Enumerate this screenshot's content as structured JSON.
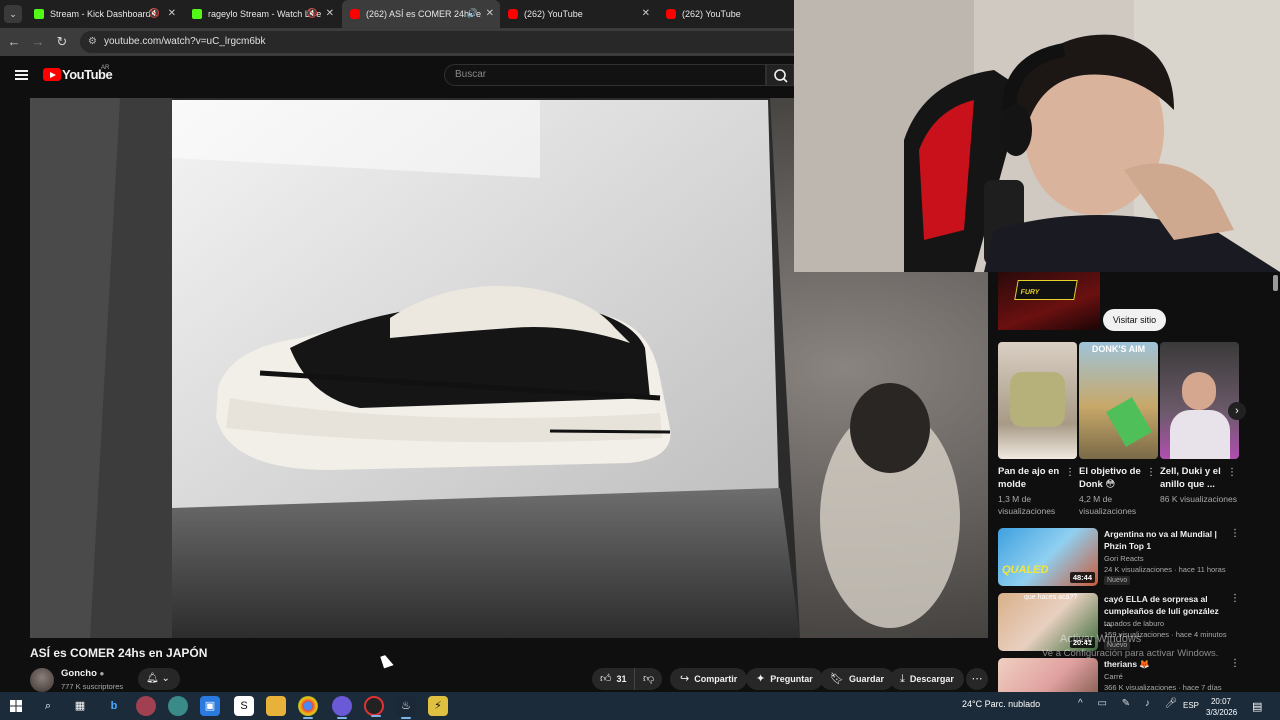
{
  "browser": {
    "tabs": [
      {
        "label": "Stream - Kick Dashboard",
        "favicon_color": "#53fc18",
        "muted": true
      },
      {
        "label": "rageylo Stream - Watch Live",
        "favicon_color": "#53fc18",
        "muted": true
      },
      {
        "label": "(262) ASÍ es COMER 24hs e",
        "favicon_color": "#ff0000",
        "active": true
      },
      {
        "label": "(262) YouTube",
        "favicon_color": "#ff0000"
      },
      {
        "label": "(262) YouTube",
        "favicon_color": "#ff0000"
      }
    ],
    "url": "youtube.com/watch?v=uC_lrgcm6bk"
  },
  "youtube": {
    "brand": "YouTube",
    "country": "AR",
    "search_placeholder": "Buscar",
    "video": {
      "title": "ASÍ es COMER 24hs en JAPÓN",
      "channel": "Goncho",
      "subscribers": "777 K suscriptores",
      "likes": "31",
      "share_label": "Compartir",
      "ask_label": "Preguntar",
      "save_label": "Guardar",
      "download_label": "Descargar"
    },
    "sidebar": {
      "ad_visit_label": "Visitar sitio",
      "ad_brand": "FURY",
      "shorts": [
        {
          "title": "Pan de ajo en molde",
          "views": "1,3 M de visualizaciones",
          "overlay": ""
        },
        {
          "title": "El objetivo de Donk 😳",
          "views": "4,2 M de visualizaciones",
          "overlay": "DONK'S AIM"
        },
        {
          "title": "Zell, Duki y el anillo que ...",
          "views": "86 K visualizaciones",
          "overlay": ""
        }
      ],
      "recommendations": [
        {
          "title": "Argentina no va al Mundial | Phzin Top 1",
          "channel": "Gori Reacts",
          "meta": "24 K visualizaciones · hace 11 horas",
          "badge": "Nuevo",
          "duration": "48:44",
          "thumb_text": "QUALED"
        },
        {
          "title": "cayó ELLA de sorpresa al cumpleaños de luli gonzález ...",
          "channel": "tapados de laburo",
          "meta": "159 visualizaciones · hace 4 minutos",
          "badge": "Nuevo",
          "duration": "20:41",
          "thumb_text": "que haces acá??"
        },
        {
          "title": "therians 🦊",
          "channel": "Carré",
          "meta": "366 K visualizaciones · hace 7 días",
          "badge": "",
          "duration": "",
          "thumb_text": ""
        }
      ]
    }
  },
  "watermark": {
    "line1": "Activar Windows",
    "line2": "Ve a Configuración para activar Windows."
  },
  "taskbar": {
    "weather": "24°C  Parc. nublado",
    "language": "ESP",
    "time": "20:07",
    "date": "3/3/2026"
  }
}
